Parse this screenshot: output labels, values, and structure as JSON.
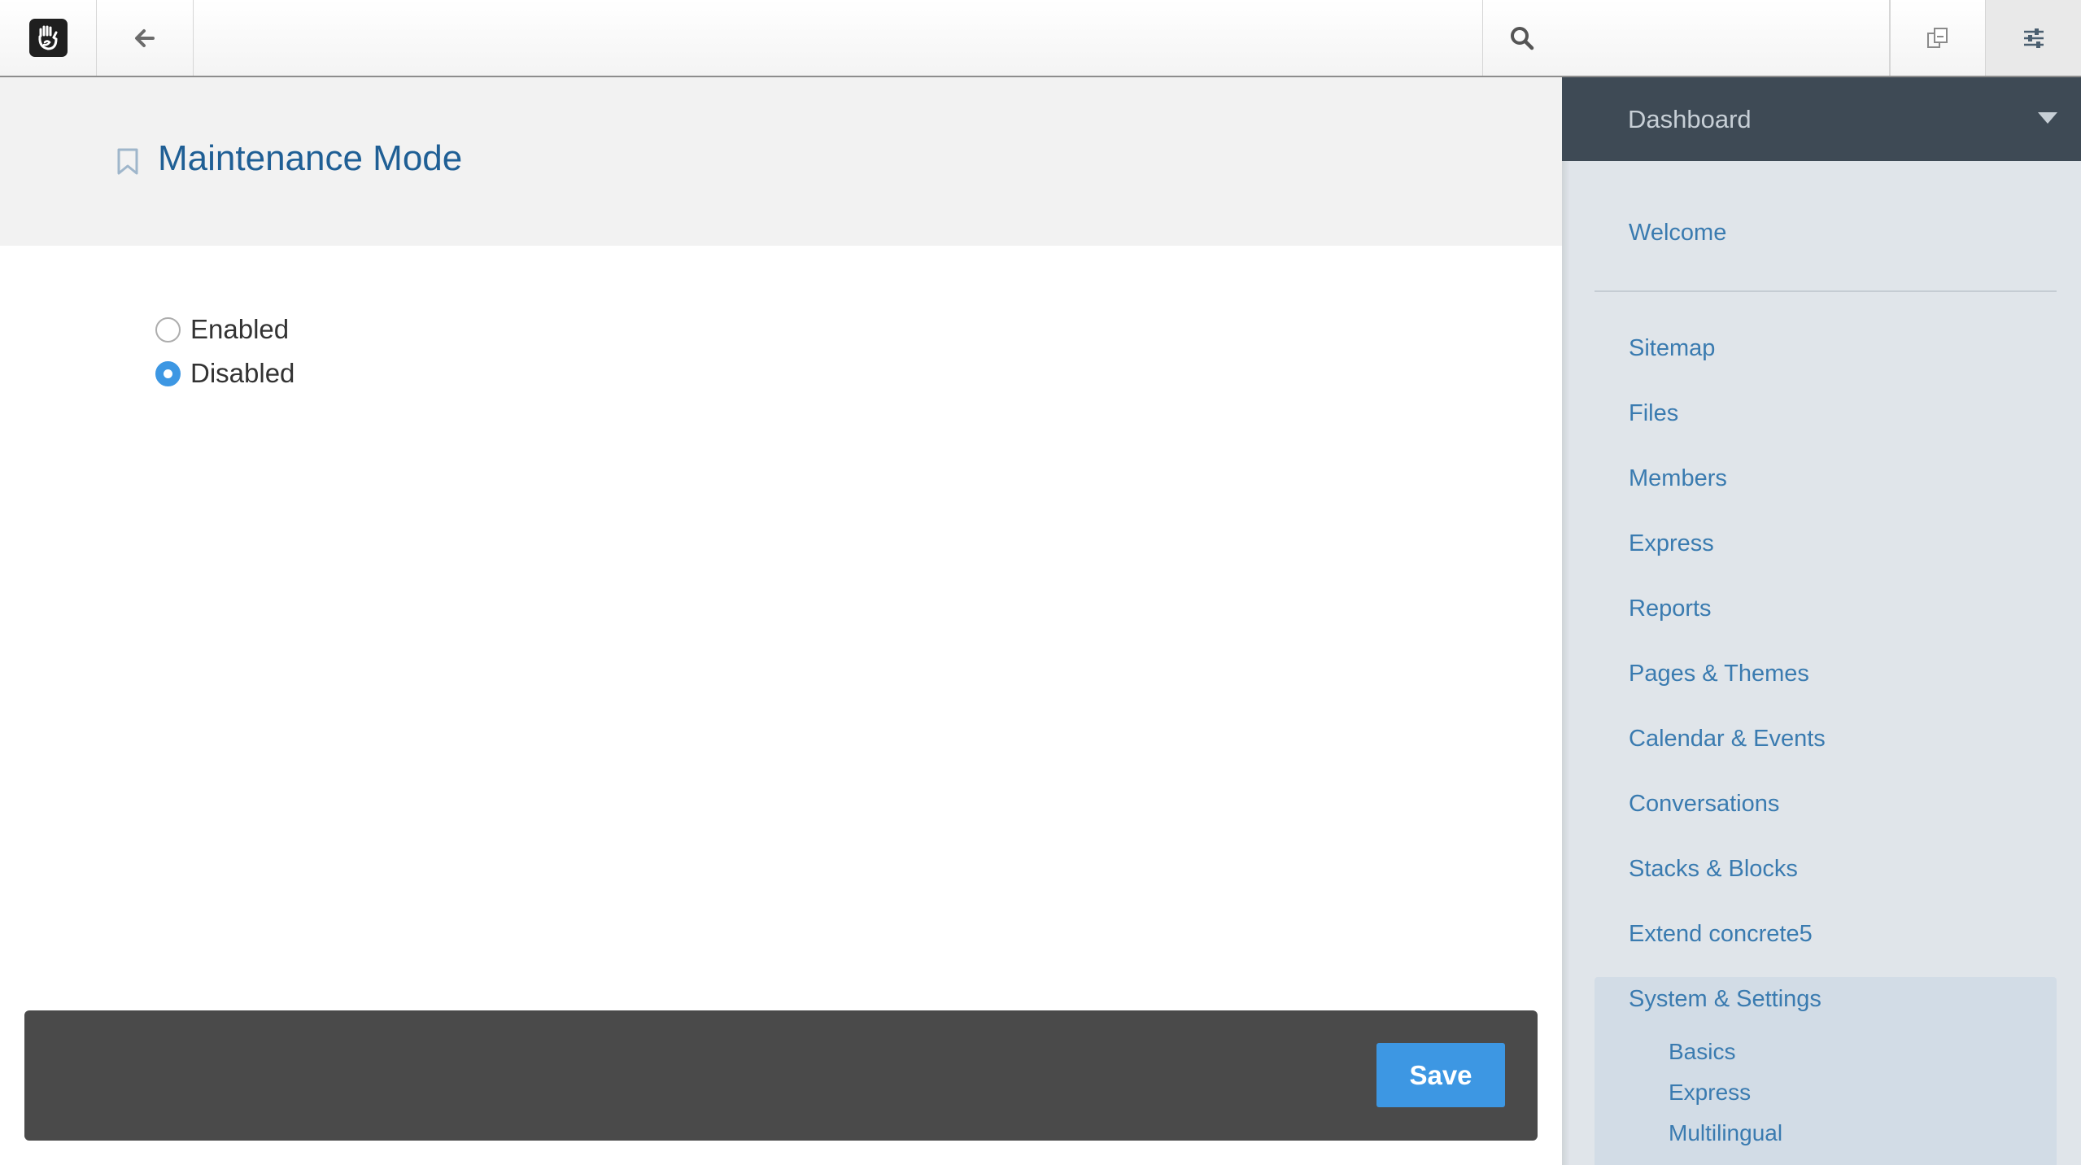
{
  "toolbar": {
    "logo_icon": "concrete5-hand-logo-icon",
    "back_icon": "arrow-left-icon",
    "search_icon": "search-icon",
    "search_placeholder": "",
    "pages_icon": "copy-pages-icon",
    "settings_icon": "sliders-icon"
  },
  "header": {
    "bookmark_icon": "bookmark-icon",
    "title": "Maintenance Mode"
  },
  "form": {
    "options": [
      {
        "label": "Enabled",
        "checked": false
      },
      {
        "label": "Disabled",
        "checked": true
      }
    ]
  },
  "footer": {
    "save_label": "Save"
  },
  "dashboard": {
    "title": "Dashboard",
    "welcome": "Welcome",
    "items": [
      "Sitemap",
      "Files",
      "Members",
      "Express",
      "Reports",
      "Pages & Themes",
      "Calendar & Events",
      "Conversations",
      "Stacks & Blocks",
      "Extend concrete5",
      "System & Settings"
    ],
    "sub_items": [
      "Basics",
      "Express",
      "Multilingual"
    ]
  },
  "colors": {
    "accent": "#3d97e3",
    "title": "#1f5f95",
    "link": "#3a7bb0",
    "panel_header": "#3e4a55",
    "panel_bg": "#e0e5ea",
    "footer_bar": "#4a4a4a"
  }
}
